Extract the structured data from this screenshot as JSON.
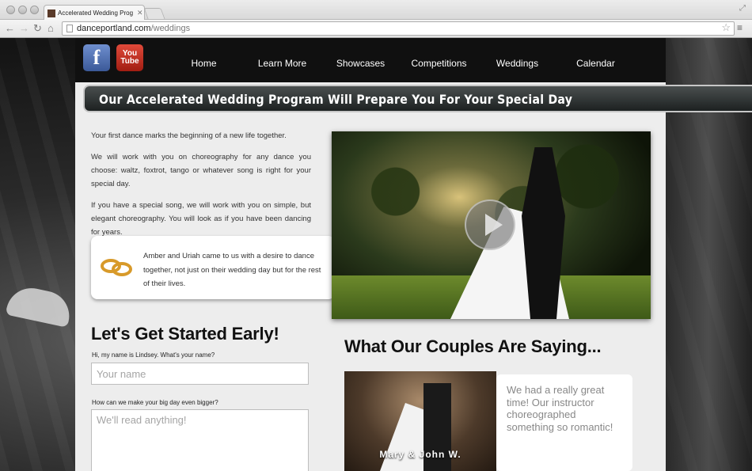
{
  "browser": {
    "tab_title": "Accelerated Wedding Prog",
    "url_domain": "danceportland.com",
    "url_path": "/weddings"
  },
  "header": {
    "social": [
      {
        "label": "f",
        "icon": "facebook-icon"
      },
      {
        "label": "You\nTube",
        "icon": "youtube-icon"
      }
    ],
    "nav": [
      "Home",
      "Learn More",
      "Showcases",
      "Competitions",
      "Weddings",
      "Calendar"
    ]
  },
  "banner": {
    "title": "Our Accelerated Wedding Program Will Prepare You For Your Special Day"
  },
  "intro": {
    "paragraphs": [
      "Your first dance marks the beginning of a new life together.",
      "We will work with you on choreography for any dance you choose: waltz, foxtrot, tango or whatever song is right for your special day.",
      "If you have a special song, we will work with you on simple, but elegant choreography. You will look as if you have been dancing for years."
    ]
  },
  "testimonial": {
    "text": "Amber and Uriah came to us with a desire to dance together, not just on their wedding day but for the rest of their lives."
  },
  "form": {
    "heading": "Let's Get Started Early!",
    "name_label": "Hi, my name is Lindsey. What's your name?",
    "name_placeholder": "Your name",
    "message_label": "How can we make your big day even bigger?",
    "message_placeholder": "We'll read anything!"
  },
  "couples": {
    "heading": "What Our Couples Are Saying...",
    "photo_caption": "Mary & John W.",
    "quote": "We had a really great time! Our instructor choreographed something so romantic!"
  },
  "colors": {
    "page_bg": "#ededed",
    "header_bg": "#101010",
    "banner_bg": "#2f3434",
    "facebook": "#3b5998",
    "youtube": "#c4302b",
    "ring_gold": "#d89a2a"
  }
}
